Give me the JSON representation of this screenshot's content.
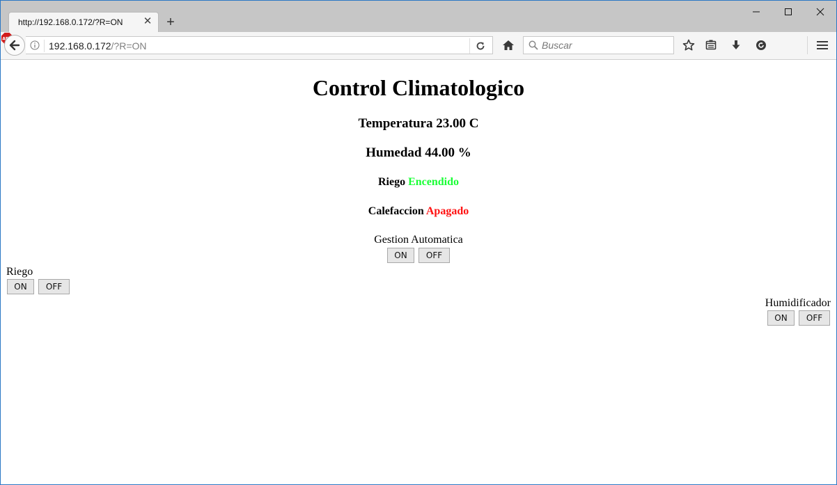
{
  "browser": {
    "tab_title": "http://192.168.0.172/?R=ON",
    "url_host": "192.168.0.172",
    "url_path": "/?R=ON",
    "search_placeholder": "Buscar"
  },
  "page": {
    "title": "Control Climatologico",
    "temperature": "Temperatura 23.00 C",
    "humidity": "Humedad 44.00 %",
    "riego_status": {
      "label": "Riego",
      "value": "Encendido",
      "color": "#19ff35"
    },
    "calefaccion_status": {
      "label": "Calefaccion",
      "value": "Apagado",
      "color": "#ff1010"
    },
    "gestion": {
      "label": "Gestion Automatica",
      "on": "ON",
      "off": "OFF"
    },
    "riego_control": {
      "label": "Riego",
      "on": "ON",
      "off": "OFF"
    },
    "humidificador": {
      "label": "Humidificador",
      "on": "ON",
      "off": "OFF"
    }
  }
}
